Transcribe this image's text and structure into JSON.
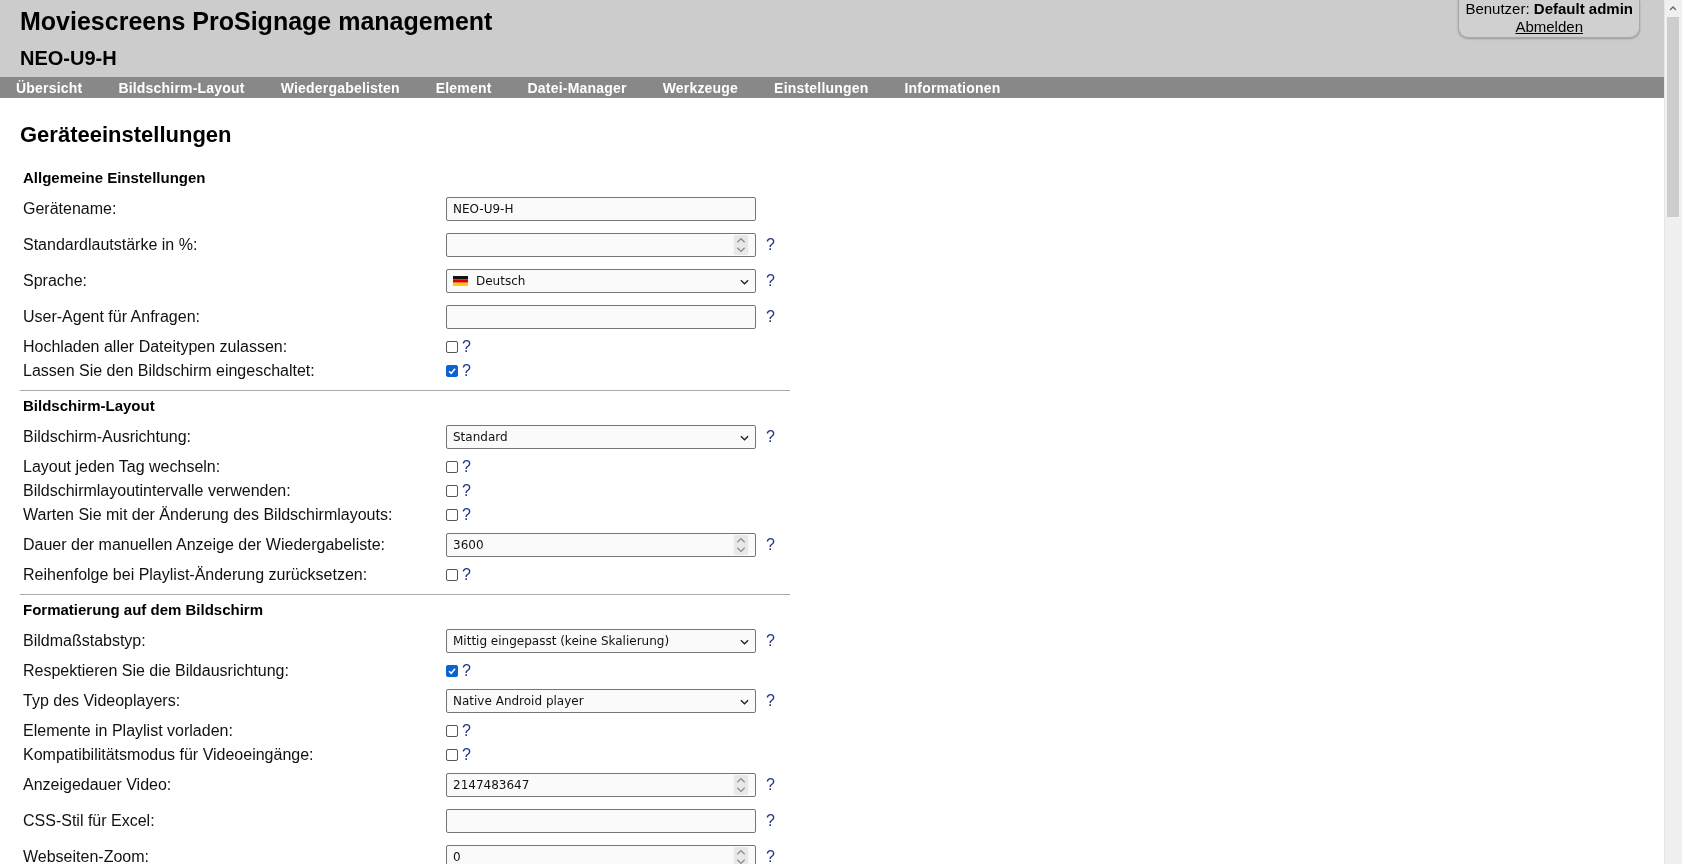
{
  "header": {
    "title": "Moviescreens ProSignage management",
    "device": "NEO-U9-H",
    "user_label": "Benutzer:",
    "user_name": "Default admin",
    "logout": "Abmelden"
  },
  "nav": [
    {
      "label": "Übersicht"
    },
    {
      "label": "Bildschirm-Layout"
    },
    {
      "label": "Wiedergabelisten"
    },
    {
      "label": "Element"
    },
    {
      "label": "Datei-Manager"
    },
    {
      "label": "Werkzeuge"
    },
    {
      "label": "Einstellungen"
    },
    {
      "label": "Informationen"
    }
  ],
  "page_title": "Geräteeinstellungen",
  "sections": [
    {
      "title": "Allgemeine Einstellungen",
      "rows": [
        {
          "kind": "text",
          "label": "Gerätename:",
          "value": "NEO-U9-H"
        },
        {
          "kind": "number",
          "label": "Standardlautstärke in %:",
          "value": "",
          "help": "?"
        },
        {
          "kind": "select",
          "label": "Sprache:",
          "value": "Deutsch",
          "flag": true,
          "help": "?"
        },
        {
          "kind": "text",
          "label": "User-Agent für Anfragen:",
          "value": "",
          "help": "?"
        },
        {
          "kind": "checkbox",
          "label": "Hochladen aller Dateitypen zulassen:",
          "checked": false,
          "help": "?"
        },
        {
          "kind": "checkbox",
          "label": "Lassen Sie den Bildschirm eingeschaltet:",
          "checked": true,
          "help": "?"
        }
      ]
    },
    {
      "title": "Bildschirm-Layout",
      "rows": [
        {
          "kind": "select",
          "label": "Bildschirm-Ausrichtung:",
          "value": "Standard",
          "help": "?"
        },
        {
          "kind": "checkbox",
          "label": "Layout jeden Tag wechseln:",
          "checked": false,
          "help": "?"
        },
        {
          "kind": "checkbox",
          "label": "Bildschirmlayoutintervalle verwenden:",
          "checked": false,
          "help": "?"
        },
        {
          "kind": "checkbox",
          "label": "Warten Sie mit der Änderung des Bildschirmlayouts:",
          "checked": false,
          "help": "?"
        },
        {
          "kind": "number",
          "label": "Dauer der manuellen Anzeige der Wiedergabeliste:",
          "value": "3600",
          "help": "?"
        },
        {
          "kind": "checkbox",
          "label": "Reihenfolge bei Playlist-Änderung zurücksetzen:",
          "checked": false,
          "help": "?"
        }
      ]
    },
    {
      "title": "Formatierung auf dem Bildschirm",
      "rows": [
        {
          "kind": "select",
          "label": "Bildmaßstabstyp:",
          "value": "Mittig eingepasst (keine Skalierung)",
          "help": "?"
        },
        {
          "kind": "checkbox",
          "label": "Respektieren Sie die Bildausrichtung:",
          "checked": true,
          "help": "?"
        },
        {
          "kind": "select",
          "label": "Typ des Videoplayers:",
          "value": "Native Android player",
          "help": "?"
        },
        {
          "kind": "checkbox",
          "label": "Elemente in Playlist vorladen:",
          "checked": false,
          "help": "?"
        },
        {
          "kind": "checkbox",
          "label": "Kompatibilitätsmodus für Videoeingänge:",
          "checked": false,
          "help": "?"
        },
        {
          "kind": "number",
          "label": "Anzeigedauer Video:",
          "value": "2147483647",
          "help": "?"
        },
        {
          "kind": "text",
          "label": "CSS-Stil für Excel:",
          "value": "",
          "help": "?"
        },
        {
          "kind": "number",
          "label": "Webseiten-Zoom:",
          "value": "0",
          "help": "?"
        }
      ]
    }
  ]
}
